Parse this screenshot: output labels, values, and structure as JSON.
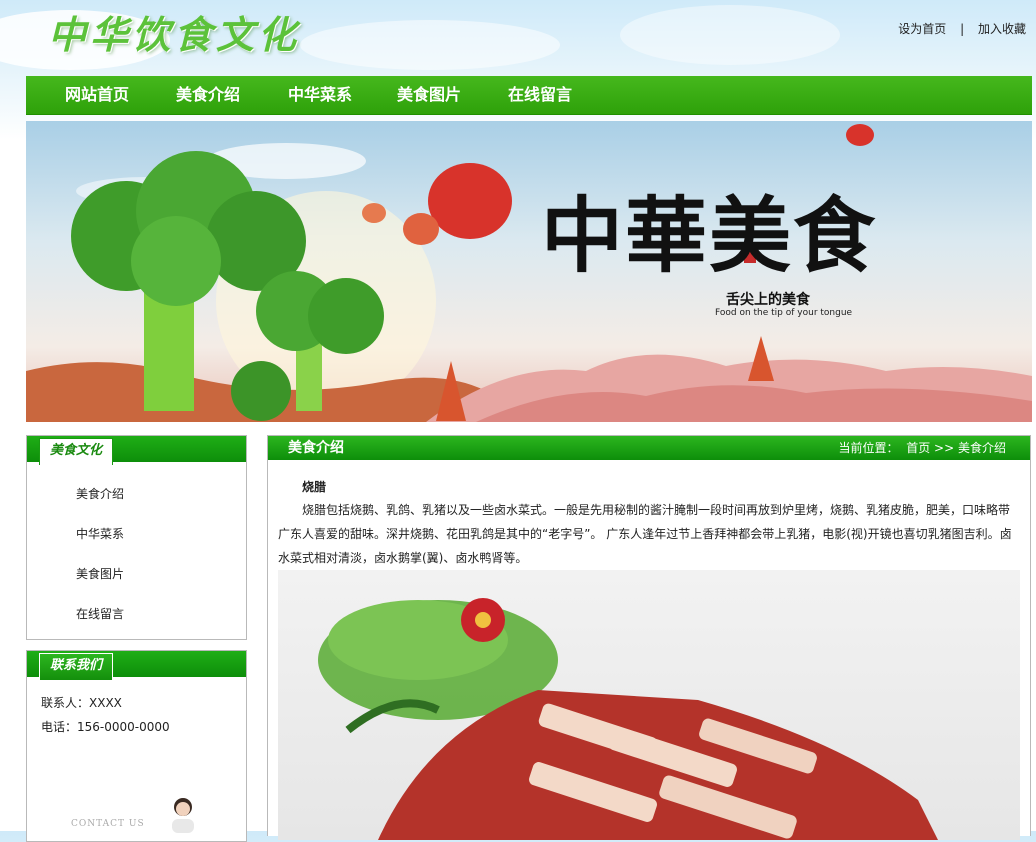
{
  "site": {
    "logo": "中华饮食文化",
    "set_home": "设为首页",
    "separator": "|",
    "add_favorite": "加入收藏"
  },
  "nav": {
    "items": [
      {
        "label": "网站首页"
      },
      {
        "label": "美食介绍"
      },
      {
        "label": "中华菜系"
      },
      {
        "label": "美食图片"
      },
      {
        "label": "在线留言"
      }
    ]
  },
  "banner": {
    "big_title": "中華美食",
    "subtitle": "舌尖上的美食",
    "tagline": "Food on the tip of your tongue"
  },
  "sidebar": {
    "culture_title": "美食文化",
    "menu": [
      {
        "label": "美食介绍"
      },
      {
        "label": "中华菜系"
      },
      {
        "label": "美食图片"
      },
      {
        "label": "在线留言"
      }
    ],
    "contact_title": "联系我们",
    "contact_person": "联系人：XXXX",
    "phone": "电话：156-0000-0000",
    "contact_us_text": "CONTACT US"
  },
  "main": {
    "title": "美食介绍",
    "crumb_label": "当前位置：",
    "crumb_home": "首页",
    "crumb_sep": ">>",
    "crumb_current": "美食介绍",
    "article_title": "烧腊",
    "article_body": "烧腊包括烧鹅、乳鸽、乳猪以及一些卤水菜式。一般是先用秘制的酱汁腌制一段时间再放到炉里烤，烧鹅、乳猪皮脆，肥美，口味略带广东人喜爱的甜味。深井烧鹅、花田乳鸽是其中的“老字号”。 广东人逢年过节上香拜神都会带上乳猪，电影(视)开镜也喜切乳猪图吉利。卤水菜式相对清淡，卤水鹅掌(翼)、卤水鸭肾等。"
  },
  "colors": {
    "nav_green": "#2ea10a",
    "logo_green": "#5cc23a",
    "head_green": "#0d8e0a"
  }
}
